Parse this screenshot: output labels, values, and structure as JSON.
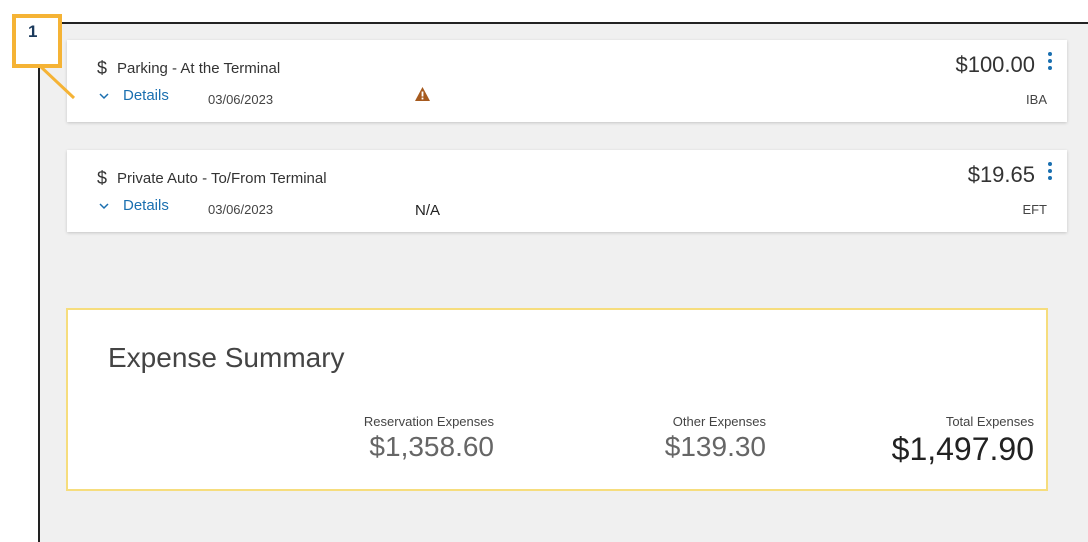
{
  "callout": {
    "number": "1"
  },
  "expenses": [
    {
      "title": "Parking - At the Terminal",
      "details_label": "Details",
      "date": "03/06/2023",
      "amount": "$100.00",
      "method": "IBA",
      "status_icon": "warning-icon",
      "status_text": ""
    },
    {
      "title": "Private Auto - To/From Terminal",
      "details_label": "Details",
      "date": "03/06/2023",
      "amount": "$19.65",
      "method": "EFT",
      "status_icon": "",
      "status_text": "N/A"
    }
  ],
  "summary": {
    "title": "Expense Summary",
    "reservation_label": "Reservation Expenses",
    "reservation_value": "$1,358.60",
    "other_label": "Other Expenses",
    "other_value": "$139.30",
    "total_label": "Total Expenses",
    "total_value": "$1,497.90"
  },
  "colors": {
    "accent": "#1a6fb0",
    "warning": "#a65a1e",
    "callout": "#f5b335",
    "summary_border": "#f6dd7d"
  }
}
